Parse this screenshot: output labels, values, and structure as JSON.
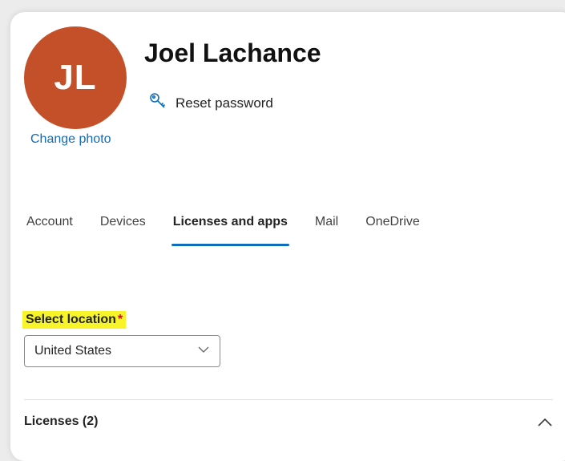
{
  "user": {
    "initials": "JL",
    "name": "Joel Lachance",
    "avatar_color": "#c4502a"
  },
  "actions": {
    "change_photo": "Change photo",
    "reset_password": "Reset password"
  },
  "tabs": [
    {
      "label": "Account",
      "active": false
    },
    {
      "label": "Devices",
      "active": false
    },
    {
      "label": "Licenses and apps",
      "active": true
    },
    {
      "label": "Mail",
      "active": false
    },
    {
      "label": "OneDrive",
      "active": false
    }
  ],
  "location": {
    "label": "Select location",
    "required_mark": "*",
    "value": "United States",
    "highlight_color": "#f7f52a"
  },
  "licenses": {
    "label": "Licenses (2)",
    "expanded": true
  },
  "icons": {
    "reset": "key-icon",
    "dropdown": "chevron-down-icon",
    "collapse": "chevron-up-icon"
  },
  "colors": {
    "accent": "#0f6cbd"
  }
}
